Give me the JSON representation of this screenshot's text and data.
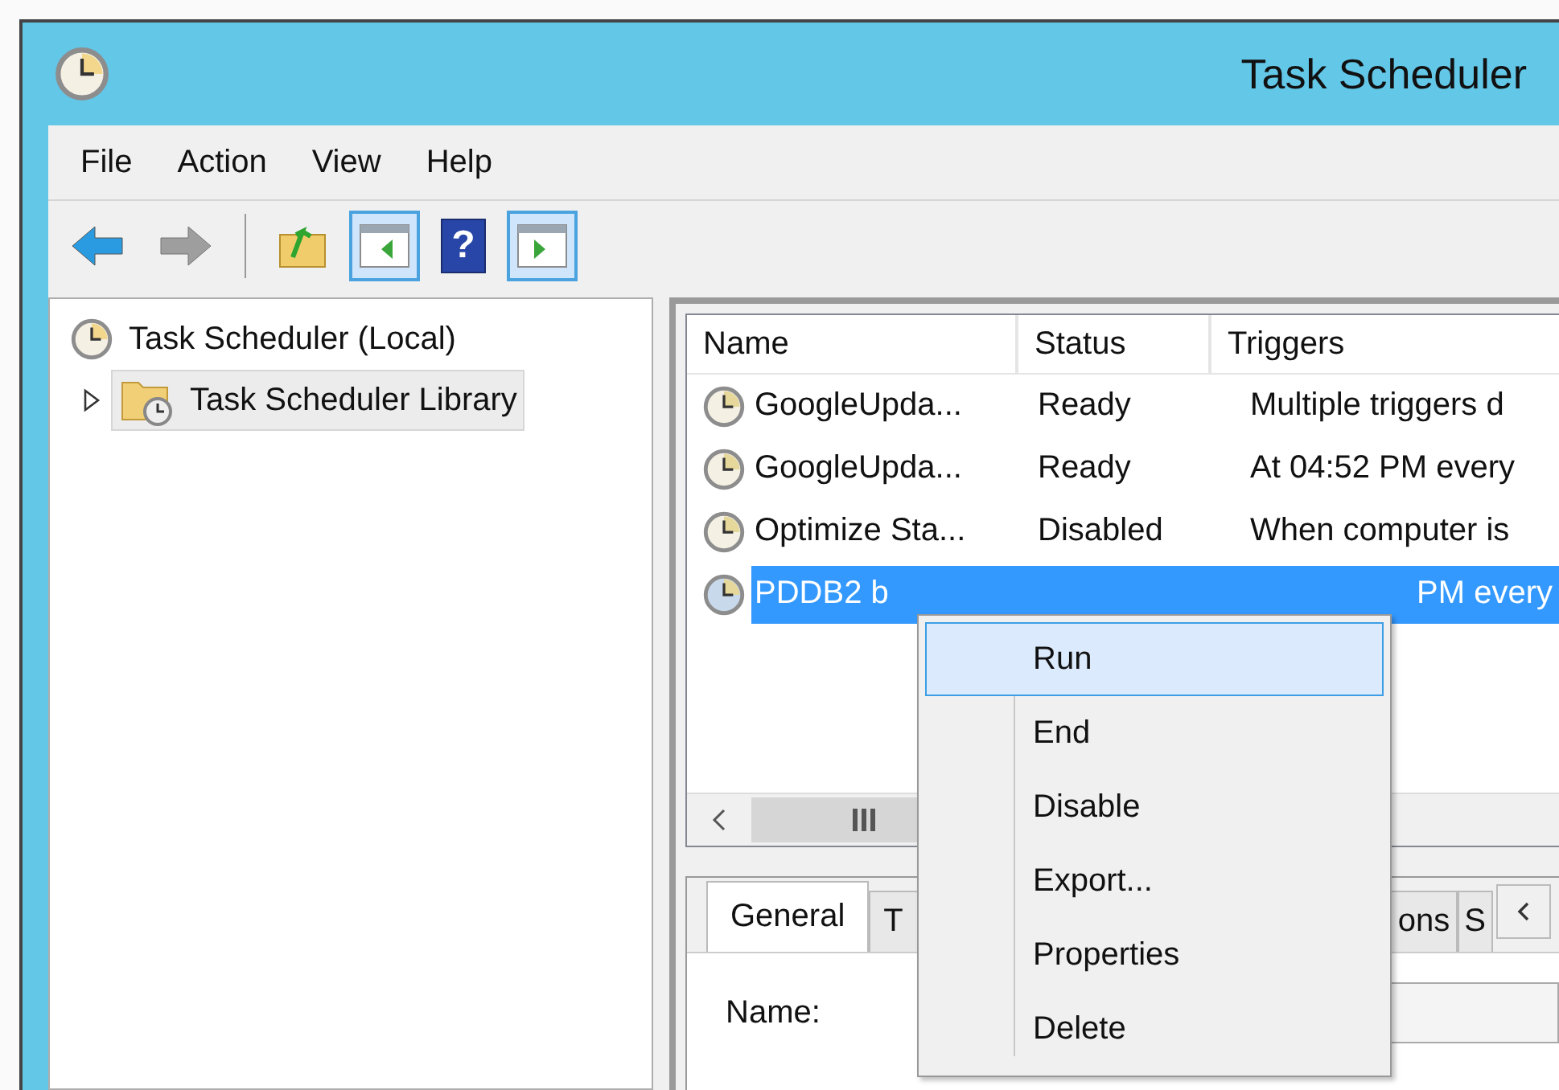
{
  "window": {
    "title": "Task Scheduler"
  },
  "menu_bar": [
    "File",
    "Action",
    "View",
    "Help"
  ],
  "toolbar": [
    {
      "kind": "back",
      "disabled": false,
      "pressed": false
    },
    {
      "kind": "forward",
      "disabled": true,
      "pressed": false
    },
    {
      "kind": "separator"
    },
    {
      "kind": "up",
      "disabled": false,
      "pressed": false
    },
    {
      "kind": "tree",
      "disabled": false,
      "pressed": true
    },
    {
      "kind": "help",
      "glyph": "?",
      "disabled": false,
      "pressed": false
    },
    {
      "kind": "actions",
      "disabled": false,
      "pressed": true
    }
  ],
  "tree": [
    {
      "label": "Task Scheduler (Local)",
      "kind": "clock",
      "selected": false,
      "children": [
        {
          "label": "Task Scheduler Library",
          "kind": "folder",
          "selected": true,
          "expanded": false
        }
      ]
    }
  ],
  "table": {
    "columns": [
      "Name",
      "Status",
      "Triggers"
    ],
    "rows": [
      {
        "name": "GoogleUpda...",
        "status": "Ready",
        "triggers": "Multiple triggers d",
        "selected": false
      },
      {
        "name": "GoogleUpda...",
        "status": "Ready",
        "triggers": "At 04:52 PM every",
        "selected": false
      },
      {
        "name": "Optimize Sta...",
        "status": "Disabled",
        "triggers": "When computer is",
        "selected": false
      },
      {
        "name": "PDDB2 b",
        "triggers": "PM every",
        "selected": true
      }
    ]
  },
  "detail_tabs": [
    {
      "label": "General",
      "selected": true
    },
    {
      "label": "T",
      "selected": false
    },
    {
      "label": "ons",
      "selected": false
    },
    {
      "label": "S",
      "selected": false
    }
  ],
  "detail_fields": [
    {
      "label": "Name:"
    }
  ],
  "context_menu": [
    {
      "label": "Run",
      "selected": true
    },
    {
      "label": "End",
      "selected": false
    },
    {
      "label": "Disable",
      "selected": false
    },
    {
      "label": "Export...",
      "selected": false
    },
    {
      "label": "Properties",
      "selected": false
    },
    {
      "label": "Delete",
      "selected": false
    }
  ]
}
